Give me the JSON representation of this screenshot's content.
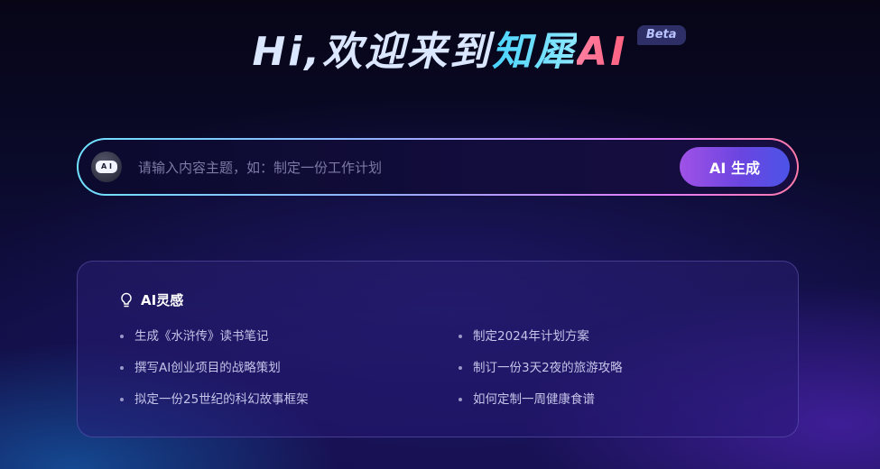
{
  "hero": {
    "title_part1": "Hi,欢迎来到",
    "title_part2": "知犀",
    "title_part3": "AI",
    "badge": "Beta"
  },
  "search": {
    "placeholder": "请输入内容主题，如：制定一份工作计划",
    "value": "",
    "avatar_text": "A I",
    "button_label": "AI 生成"
  },
  "ideas": {
    "title": "AI灵感",
    "left": [
      "生成《水浒传》读书笔记",
      "撰写AI创业项目的战略策划",
      "拟定一份25世纪的科幻故事框架"
    ],
    "right": [
      "制定2024年计划方案",
      "制订一份3天2夜的旅游攻略",
      "如何定制一周健康食谱"
    ]
  }
}
